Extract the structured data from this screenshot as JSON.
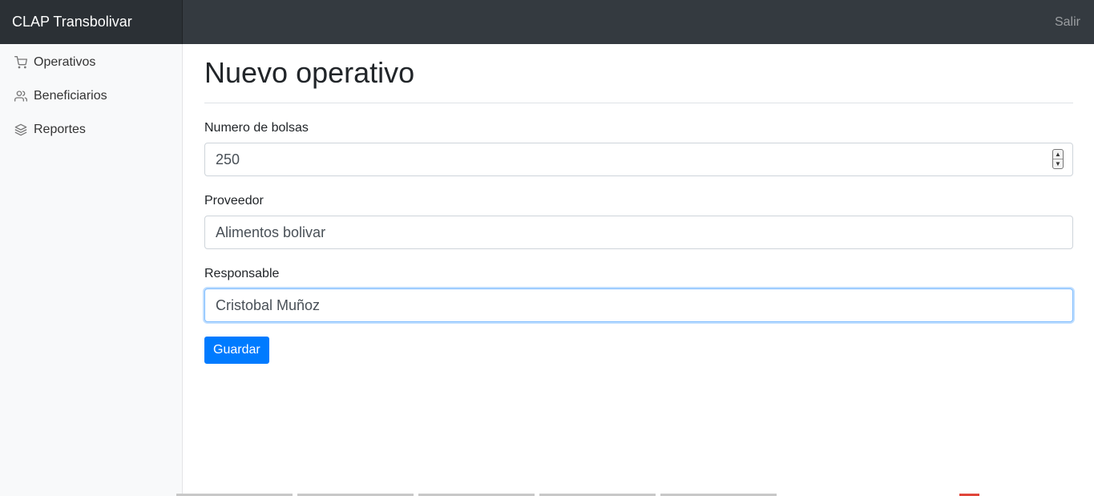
{
  "header": {
    "brand": "CLAP Transbolivar",
    "signout": "Salir"
  },
  "sidebar": {
    "items": [
      {
        "label": "Operativos",
        "icon": "shopping-cart-icon"
      },
      {
        "label": "Beneficiarios",
        "icon": "users-icon"
      },
      {
        "label": "Reportes",
        "icon": "layers-icon"
      }
    ]
  },
  "main": {
    "title": "Nuevo operativo",
    "fields": {
      "bags": {
        "label": "Numero de bolsas",
        "value": "250"
      },
      "provider": {
        "label": "Proveedor",
        "value": "Alimentos bolivar"
      },
      "responsible": {
        "label": "Responsable",
        "value": "Cristobal Muñoz"
      }
    },
    "save_label": "Guardar"
  },
  "colors": {
    "primary": "#007bff",
    "navbar": "#343a40",
    "sidebar": "#f8f9fa"
  }
}
